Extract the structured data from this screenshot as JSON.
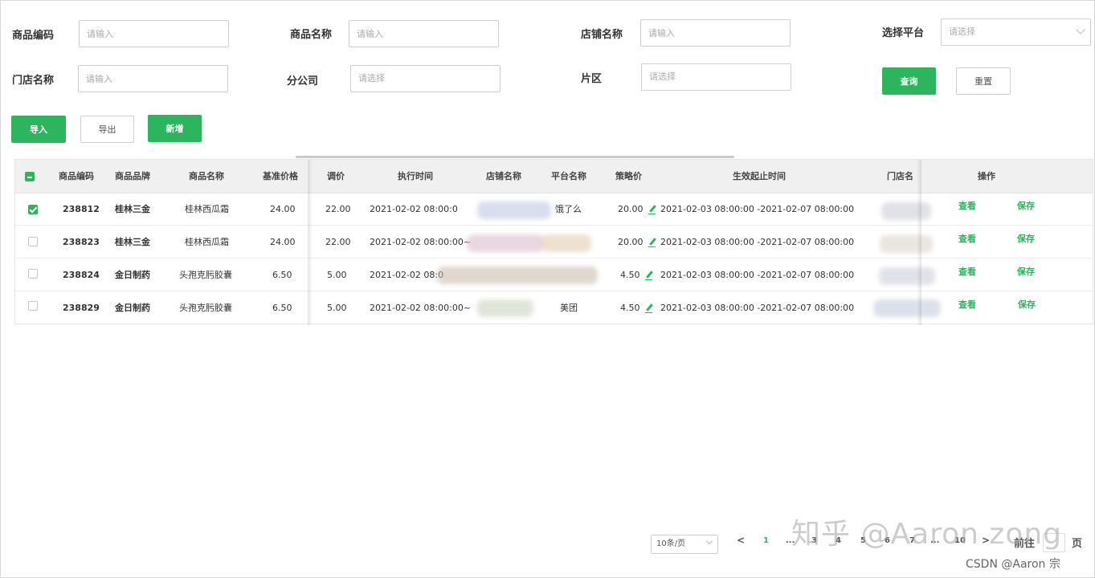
{
  "filters": {
    "product_code": {
      "label": "商品编码",
      "placeholder": "请输入"
    },
    "product_name": {
      "label": "商品名称",
      "placeholder": "请输入"
    },
    "shop_name": {
      "label": "店铺名称",
      "placeholder": "请输入"
    },
    "platform": {
      "label": "选择平台",
      "placeholder": "请选择"
    },
    "store_name": {
      "label": "门店名称",
      "placeholder": "请输入"
    },
    "branch": {
      "label": "分公司",
      "placeholder": "请选择"
    },
    "area": {
      "label": "片区",
      "placeholder": "请选择"
    },
    "query_label": "查询",
    "reset_label": "重置"
  },
  "toolbar": {
    "import_label": "导入",
    "export_label": "导出",
    "add_label": "新增"
  },
  "table": {
    "headers": {
      "code": "商品编码",
      "brand": "商品品牌",
      "name": "商品名称",
      "base_price": "基准价格",
      "adjust": "调价",
      "exec_time": "执行时间",
      "shop": "店铺名称",
      "platform": "平台名称",
      "strategy": "策略价",
      "valid_period": "生效起止时间",
      "store": "门店名",
      "action": "操作"
    },
    "rows": [
      {
        "checked": true,
        "code": "238812",
        "brand": "桂林三金",
        "name": "桂林西瓜霜",
        "base_price": "24.00",
        "adjust": "22.00",
        "exec_time": "2021-02-02  08:00:0",
        "platform": "饿了么",
        "strategy": "20.00",
        "valid_period": "2021-02-03  08:00:00 -2021-02-07  08:00:00",
        "view": "查看",
        "save": "保存"
      },
      {
        "checked": false,
        "code": "238823",
        "brand": "桂林三金",
        "name": "桂林西瓜霜",
        "base_price": "24.00",
        "adjust": "22.00",
        "exec_time": "2021-02-02  08:00:00~",
        "platform": "",
        "strategy": "20.00",
        "valid_period": "2021-02-03  08:00:00 -2021-02-07  08:00:00",
        "view": "查看",
        "save": "保存"
      },
      {
        "checked": false,
        "code": "238824",
        "brand": "金日制药",
        "name": "头孢克肟胶囊",
        "base_price": "6.50",
        "adjust": "5.00",
        "exec_time": "2021-02-02  08:0",
        "platform": "",
        "strategy": "4.50",
        "valid_period": "2021-02-03  08:00:00 -2021-02-07  08:00:00",
        "view": "查看",
        "save": "保存"
      },
      {
        "checked": false,
        "code": "238829",
        "brand": "金日制药",
        "name": "头孢克肟胶囊",
        "base_price": "6.50",
        "adjust": "5.00",
        "exec_time": "2021-02-02  08:00:00~",
        "platform": "美团",
        "strategy": "4.50",
        "valid_period": "2021-02-03  08:00:00 -2021-02-07  08:00:00",
        "view": "查看",
        "save": "保存"
      }
    ]
  },
  "pagination": {
    "page_size": "10条/页",
    "prev": "<",
    "next": ">",
    "pages": [
      "1",
      "...",
      "3",
      "4",
      "5",
      "6",
      "7",
      "...",
      "10"
    ],
    "goto_label": "前往",
    "page_suffix": "页"
  },
  "watermark": {
    "zhihu": "知乎 @Aaron zong",
    "csdn": "CSDN @Aaron 宗"
  },
  "colors": {
    "accent": "#2db55d",
    "header_bg": "#f0f0f0"
  }
}
